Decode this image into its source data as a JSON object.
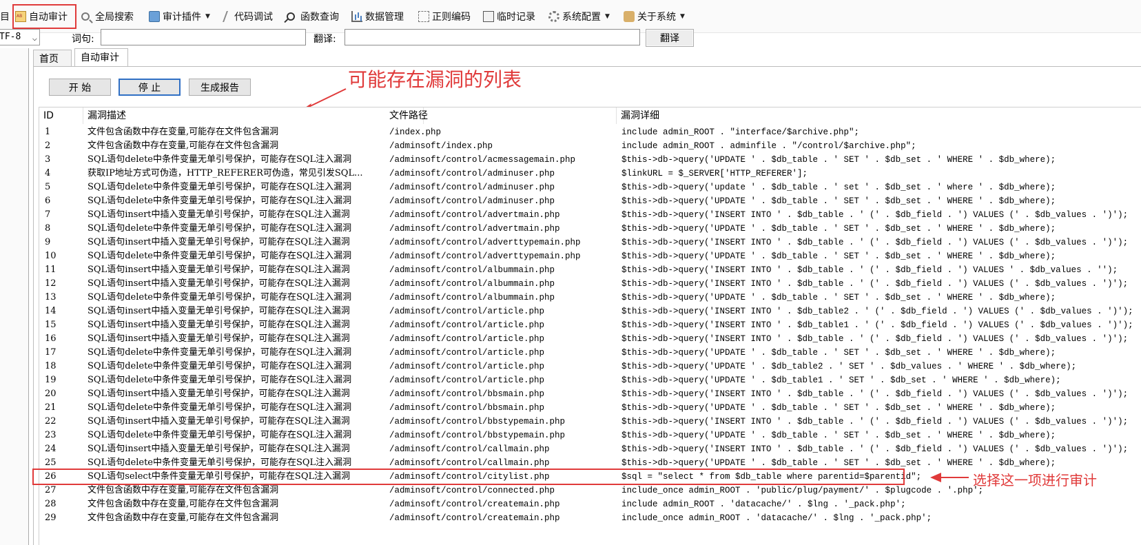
{
  "toolbar": {
    "partial_first": "目",
    "items": [
      {
        "label": "自动审计",
        "icon": "audit-icon"
      },
      {
        "label": "全局搜索",
        "icon": "search-icon"
      },
      {
        "label": "审计插件",
        "icon": "plugin-icon",
        "dropdown": true
      },
      {
        "label": "代码调试",
        "icon": "debug-icon"
      },
      {
        "label": "函数查询",
        "icon": "magnifier-icon"
      },
      {
        "label": "数据管理",
        "icon": "chart-icon"
      },
      {
        "label": "正则编码",
        "icon": "regex-icon"
      },
      {
        "label": "临时记录",
        "icon": "note-icon"
      },
      {
        "label": "系统配置",
        "icon": "gear-icon",
        "dropdown": true
      },
      {
        "label": "关于系统",
        "icon": "about-icon",
        "dropdown": true
      }
    ],
    "highlight_color": "#e03a3a"
  },
  "search_row": {
    "encoding_value": "TF-8",
    "word_label": "词句:",
    "word_value": "",
    "translate_label": "翻译:",
    "translate_value": "",
    "translate_button": "翻译"
  },
  "tabs": [
    {
      "label": "首页",
      "active": false
    },
    {
      "label": "自动审计",
      "active": true
    }
  ],
  "buttons": {
    "start": "开 始",
    "stop": "停 止",
    "report": "生成报告"
  },
  "annotations": {
    "list_note": "可能存在漏洞的列表",
    "select_note": "选择这一项进行审计",
    "color": "#e03a3a"
  },
  "columns": {
    "id": "ID",
    "desc": "漏洞描述",
    "path": "文件路径",
    "detail": "漏洞详细"
  },
  "rows": [
    {
      "id": "1",
      "desc": "文件包含函数中存在变量,可能存在文件包含漏洞",
      "path": "/index.php",
      "detail": "include admin_ROOT . \"interface/$archive.php\";"
    },
    {
      "id": "2",
      "desc": "文件包含函数中存在变量,可能存在文件包含漏洞",
      "path": "/adminsoft/index.php",
      "detail": "include admin_ROOT . adminfile . \"/control/$archive.php\";"
    },
    {
      "id": "3",
      "desc": "SQL语句delete中条件变量无单引号保护，可能存在SQL注入漏洞",
      "path": "/adminsoft/control/acmessagemain.php",
      "detail": "$this->db->query('UPDATE ' . $db_table . ' SET ' . $db_set . ' WHERE ' . $db_where);"
    },
    {
      "id": "4",
      "desc": "获取IP地址方式可伪造，HTTP_REFERER可伪造，常见引发SQL...",
      "path": "/adminsoft/control/adminuser.php",
      "detail": "$linkURL = $_SERVER['HTTP_REFERER'];"
    },
    {
      "id": "5",
      "desc": "SQL语句delete中条件变量无单引号保护，可能存在SQL注入漏洞",
      "path": "/adminsoft/control/adminuser.php",
      "detail": "$this->db->query('update ' . $db_table . ' set ' . $db_set . ' where ' . $db_where);"
    },
    {
      "id": "6",
      "desc": "SQL语句delete中条件变量无单引号保护，可能存在SQL注入漏洞",
      "path": "/adminsoft/control/adminuser.php",
      "detail": "$this->db->query('UPDATE ' . $db_table . ' SET ' . $db_set . ' WHERE ' . $db_where);"
    },
    {
      "id": "7",
      "desc": "SQL语句insert中插入变量无单引号保护，可能存在SQL注入漏洞",
      "path": "/adminsoft/control/advertmain.php",
      "detail": "$this->db->query('INSERT INTO ' . $db_table . ' (' . $db_field . ') VALUES (' . $db_values . ')');"
    },
    {
      "id": "8",
      "desc": "SQL语句delete中条件变量无单引号保护，可能存在SQL注入漏洞",
      "path": "/adminsoft/control/advertmain.php",
      "detail": "$this->db->query('UPDATE ' . $db_table . ' SET ' . $db_set . ' WHERE ' . $db_where);"
    },
    {
      "id": "9",
      "desc": "SQL语句insert中插入变量无单引号保护，可能存在SQL注入漏洞",
      "path": "/adminsoft/control/adverttypemain.php",
      "detail": "$this->db->query('INSERT INTO ' . $db_table . ' (' . $db_field . ') VALUES (' . $db_values . ')');"
    },
    {
      "id": "10",
      "desc": "SQL语句delete中条件变量无单引号保护，可能存在SQL注入漏洞",
      "path": "/adminsoft/control/adverttypemain.php",
      "detail": "$this->db->query('UPDATE ' . $db_table . ' SET ' . $db_set . ' WHERE ' . $db_where);"
    },
    {
      "id": "11",
      "desc": "SQL语句insert中插入变量无单引号保护，可能存在SQL注入漏洞",
      "path": "/adminsoft/control/albummain.php",
      "detail": "$this->db->query('INSERT INTO ' . $db_table . ' (' . $db_field . ') VALUES ' . $db_values . '');"
    },
    {
      "id": "12",
      "desc": "SQL语句insert中插入变量无单引号保护，可能存在SQL注入漏洞",
      "path": "/adminsoft/control/albummain.php",
      "detail": "$this->db->query('INSERT INTO ' . $db_table . ' (' . $db_field . ') VALUES (' . $db_values . ')');"
    },
    {
      "id": "13",
      "desc": "SQL语句delete中条件变量无单引号保护，可能存在SQL注入漏洞",
      "path": "/adminsoft/control/albummain.php",
      "detail": "$this->db->query('UPDATE ' . $db_table . ' SET ' . $db_set . ' WHERE ' . $db_where);"
    },
    {
      "id": "14",
      "desc": "SQL语句insert中插入变量无单引号保护，可能存在SQL注入漏洞",
      "path": "/adminsoft/control/article.php",
      "detail": "$this->db->query('INSERT INTO ' . $db_table2 . ' (' . $db_field . ') VALUES (' . $db_values . ')');"
    },
    {
      "id": "15",
      "desc": "SQL语句insert中插入变量无单引号保护，可能存在SQL注入漏洞",
      "path": "/adminsoft/control/article.php",
      "detail": "$this->db->query('INSERT INTO ' . $db_table1 . ' (' . $db_field . ') VALUES (' . $db_values . ')');"
    },
    {
      "id": "16",
      "desc": "SQL语句insert中插入变量无单引号保护，可能存在SQL注入漏洞",
      "path": "/adminsoft/control/article.php",
      "detail": "$this->db->query('INSERT INTO ' . $db_table . ' (' . $db_field . ') VALUES (' . $db_values . ')');"
    },
    {
      "id": "17",
      "desc": "SQL语句delete中条件变量无单引号保护，可能存在SQL注入漏洞",
      "path": "/adminsoft/control/article.php",
      "detail": "$this->db->query('UPDATE ' . $db_table . ' SET ' . $db_set . ' WHERE ' . $db_where);"
    },
    {
      "id": "18",
      "desc": "SQL语句delete中条件变量无单引号保护，可能存在SQL注入漏洞",
      "path": "/adminsoft/control/article.php",
      "detail": "$this->db->query('UPDATE ' . $db_table2 . ' SET ' . $db_values . ' WHERE ' . $db_where);"
    },
    {
      "id": "19",
      "desc": "SQL语句delete中条件变量无单引号保护，可能存在SQL注入漏洞",
      "path": "/adminsoft/control/article.php",
      "detail": "$this->db->query('UPDATE ' . $db_table1 . ' SET ' . $db_set . ' WHERE ' . $db_where);"
    },
    {
      "id": "20",
      "desc": "SQL语句insert中插入变量无单引号保护，可能存在SQL注入漏洞",
      "path": "/adminsoft/control/bbsmain.php",
      "detail": "$this->db->query('INSERT INTO ' . $db_table . ' (' . $db_field . ') VALUES (' . $db_values . ')');"
    },
    {
      "id": "21",
      "desc": "SQL语句delete中条件变量无单引号保护，可能存在SQL注入漏洞",
      "path": "/adminsoft/control/bbsmain.php",
      "detail": "$this->db->query('UPDATE ' . $db_table . ' SET ' . $db_set . ' WHERE ' . $db_where);"
    },
    {
      "id": "22",
      "desc": "SQL语句insert中插入变量无单引号保护，可能存在SQL注入漏洞",
      "path": "/adminsoft/control/bbstypemain.php",
      "detail": "$this->db->query('INSERT INTO ' . $db_table . ' (' . $db_field . ') VALUES (' . $db_values . ')');"
    },
    {
      "id": "23",
      "desc": "SQL语句delete中条件变量无单引号保护，可能存在SQL注入漏洞",
      "path": "/adminsoft/control/bbstypemain.php",
      "detail": "$this->db->query('UPDATE ' . $db_table . ' SET ' . $db_set . ' WHERE ' . $db_where);"
    },
    {
      "id": "24",
      "desc": "SQL语句insert中插入变量无单引号保护，可能存在SQL注入漏洞",
      "path": "/adminsoft/control/callmain.php",
      "detail": "$this->db->query('INSERT INTO ' . $db_table . ' (' . $db_field . ') VALUES (' . $db_values . ')');"
    },
    {
      "id": "25",
      "desc": "SQL语句delete中条件变量无单引号保护，可能存在SQL注入漏洞",
      "path": "/adminsoft/control/callmain.php",
      "detail": "$this->db->query('UPDATE ' . $db_table . ' SET ' . $db_set . ' WHERE ' . $db_where);"
    },
    {
      "id": "26",
      "desc": "SQL语句select中条件变量无单引号保护，可能存在SQL注入漏洞",
      "path": "/adminsoft/control/citylist.php",
      "detail": "$sql = \"select * from $db_table where parentid=$parentid\";",
      "selected": true
    },
    {
      "id": "27",
      "desc": "文件包含函数中存在变量,可能存在文件包含漏洞",
      "path": "/adminsoft/control/connected.php",
      "detail": "include_once admin_ROOT . 'public/plug/payment/' . $plugcode . '.php';"
    },
    {
      "id": "28",
      "desc": "文件包含函数中存在变量,可能存在文件包含漏洞",
      "path": "/adminsoft/control/createmain.php",
      "detail": "include admin_ROOT . 'datacache/' . $lng . '_pack.php';"
    },
    {
      "id": "29",
      "desc": "文件包含函数中存在变量,可能存在文件包含漏洞",
      "path": "/adminsoft/control/createmain.php",
      "detail": "include_once admin_ROOT . 'datacache/' . $lng . '_pack.php';"
    }
  ]
}
